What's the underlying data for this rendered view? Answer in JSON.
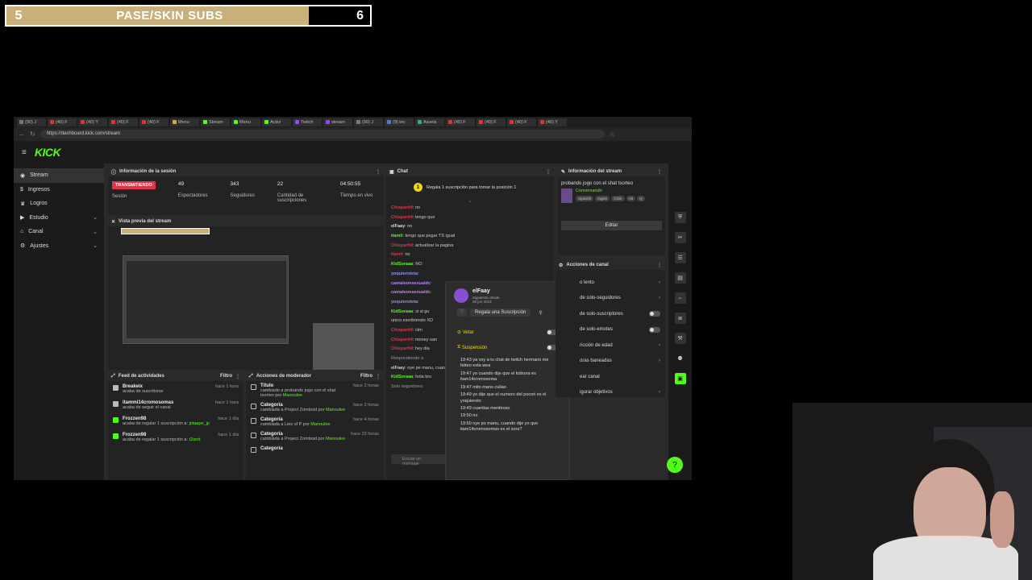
{
  "overlay": {
    "left_count": "5",
    "title": "PASE/SKIN SUBS",
    "right_count": "6"
  },
  "browser": {
    "tabs": [
      {
        "label": "(90) J",
        "color": "#777"
      },
      {
        "label": "(40) F",
        "color": "#d33"
      },
      {
        "label": "(40) Y",
        "color": "#d33"
      },
      {
        "label": "(40) F",
        "color": "#d33"
      },
      {
        "label": "(40) F",
        "color": "#d33"
      },
      {
        "label": "Menu",
        "color": "#c9b040"
      },
      {
        "label": "Stream",
        "color": "#53fc18"
      },
      {
        "label": "Menu",
        "color": "#53fc18"
      },
      {
        "label": "Activi",
        "color": "#53fc18"
      },
      {
        "label": "Twitch",
        "color": "#9146ff"
      },
      {
        "label": "stream",
        "color": "#9146ff"
      },
      {
        "label": "(90) J",
        "color": "#777"
      },
      {
        "label": "(9) tec",
        "color": "#4a7bd9"
      },
      {
        "label": "Assets",
        "color": "#3a9"
      },
      {
        "label": "(40) F",
        "color": "#d33"
      },
      {
        "label": "(40) F",
        "color": "#d33"
      },
      {
        "label": "(40) F",
        "color": "#d33"
      },
      {
        "label": "(40) Y",
        "color": "#d33"
      }
    ],
    "url": "https://dashboard.kick.com/stream"
  },
  "kick": {
    "logo": "KICK",
    "sidebar": [
      {
        "label": "Stream",
        "icon": "broadcast-icon",
        "active": true,
        "chevron": false
      },
      {
        "label": "Ingresos",
        "icon": "money-icon",
        "active": false,
        "chevron": false
      },
      {
        "label": "Logros",
        "icon": "trophy-icon",
        "active": false,
        "chevron": false
      },
      {
        "label": "Estudio",
        "icon": "video-icon",
        "active": false,
        "chevron": true
      },
      {
        "label": "Canal",
        "icon": "channel-icon",
        "active": false,
        "chevron": true
      },
      {
        "label": "Ajustes",
        "icon": "gear-icon",
        "active": false,
        "chevron": true
      }
    ],
    "session": {
      "title": "Información de la sesión",
      "live_badge": "TRANSMITIENDO",
      "live_sub": "Sesión",
      "stats": [
        {
          "value": "49",
          "label": "Espectadores"
        },
        {
          "value": "343",
          "label": "Seguidores"
        },
        {
          "value": "22",
          "label": "Cantidad de suscripciones"
        },
        {
          "value": "04:50:55",
          "label": "Tiempo en vivo"
        }
      ]
    },
    "preview_title": "Vista previa del stream",
    "activity": {
      "title": "Feed de actividades",
      "filter": "Filtro",
      "items": [
        {
          "name": "Breakeix",
          "text": "acaba de suscribirse",
          "time": "hace 1 hora",
          "color": "#bbb"
        },
        {
          "name": "itammi14cromosomas",
          "text": "acaba de seguir el canal",
          "time": "hace 1 hora",
          "color": "#bbb"
        },
        {
          "name": "Frozzen98",
          "text": "acaba de regalar 1 suscripción a: ",
          "target": "jotaape_jp",
          "time": "hace 1 día",
          "color": "#53fc18"
        },
        {
          "name": "Frozzen98",
          "text": "acaba de regalar 1 suscripción a: ",
          "target": "t2arot",
          "time": "hace 1 día",
          "color": "#53fc18"
        }
      ]
    },
    "mod_actions": {
      "title": "Acciones de moderador",
      "filter": "Filtro",
      "items": [
        {
          "name": "Título",
          "text": "cambiado a probando jogo con el shat tsorteo por",
          "by": "Manoulee",
          "time": "hace 2 horas"
        },
        {
          "name": "Categoría",
          "text": "cambiada a Project Zomboid por",
          "by": "Manoulee",
          "time": "hace 2 horas"
        },
        {
          "name": "Categoría",
          "text": "cambiada a Lies of P por",
          "by": "Manoulee",
          "time": "hace 4 horas"
        },
        {
          "name": "Categoría",
          "text": "cambiada a Project Zomboid por",
          "by": "Manoulee",
          "time": "hace 23 horas"
        },
        {
          "name": "Categoría",
          "text": "",
          "by": "",
          "time": ""
        }
      ]
    },
    "chat": {
      "title": "Chat",
      "pinned": "Regala 1 suscripción para tomar la posición 1",
      "lines": [
        {
          "user": "Chisparit4",
          "msg": "no",
          "color": "#e0344a"
        },
        {
          "user": "Chisparit4",
          "msg": "tengo que",
          "color": "#e0344a"
        },
        {
          "user": "elFaay",
          "msg": "no",
          "color": "#ddd"
        },
        {
          "user": "itamii",
          "msg": "tengo que pegar TS igual",
          "color": "#53fc18"
        },
        {
          "user": "Chisparit4",
          "msg": "actualizar la pagina",
          "color": "#e0344a"
        },
        {
          "user": "itamii",
          "msg": "no",
          "color": "#e0344a"
        },
        {
          "user": "KidSoraaa",
          "msg": "NO",
          "color": "#53fc18"
        },
        {
          "user": "yoquieroteta",
          "msg": "",
          "color": "#8f8fff"
        },
        {
          "user": "camaleonsexualdc",
          "msg": "",
          "color": "#c080ff"
        },
        {
          "user": "camaleonsexualdc",
          "msg": "",
          "color": "#c080ff"
        },
        {
          "user": "yoquieroteta",
          "msg": "",
          "color": "#8f8fff"
        },
        {
          "user": "KidSoraaa",
          "msg": "si si gu",
          "color": "#53fc18"
        },
        {
          "user": "",
          "msg": "unico escribiendo XD",
          "color": "#ddd"
        },
        {
          "user": "Chisparit4",
          "msg": "ctm",
          "color": "#e0344a"
        },
        {
          "user": "Chisparit4",
          "msg": "money uan",
          "color": "#e0344a"
        },
        {
          "user": "Chisparit4",
          "msg": "hey dia",
          "color": "#e0344a"
        }
      ],
      "reply_label": "Respondiendo a",
      "reply_user": "elFaay",
      "reply_msg": "oye pe manu, cuando dije yo que es sora?",
      "reply2_user": "KidSoraaa",
      "reply2_msg": "hola bro",
      "followers_only": "Solo seguidores",
      "input_placeholder": "Enviar un mensaje"
    },
    "usercard": {
      "name": "elFaay",
      "follow_label": "Siguiendo desde",
      "follow_date": "28 jun 2023",
      "gift_button": "Regala una Suscripción",
      "vetar": "Vetar",
      "suspension": "Suspensión",
      "messages": [
        "19:43 ya voy a tu chat de twitch hermano me fatteo esta wea",
        "19:47 yo cuando dije que el kidsora es itam14cromosoma",
        "19:47 mito mano culiao",
        "19:49 yo dije que el numero del pocori es el yoquieroto",
        "19:49 cuantias mentiroso",
        "19:50 no",
        "19:50 oye po manu, cuando dije yo que itam14cromosomas es el sora?"
      ]
    },
    "stream_info": {
      "title": "Información del stream",
      "stream_title": "probando jogo con el shat tsorteo",
      "category": "Conversando",
      "tags": [
        "Spanish",
        "Ingles",
        "Chile",
        "Hit",
        "ry"
      ],
      "edit_button": "Editar"
    },
    "channel_actions": {
      "title": "Acciones de canal",
      "items": [
        {
          "label": "o lento",
          "control": "chevron"
        },
        {
          "label": "de solo-seguidores",
          "control": "chevron"
        },
        {
          "label": "de solo-suscriptores",
          "control": "toggle"
        },
        {
          "label": "de solo-emotes",
          "control": "toggle"
        },
        {
          "label": "ricción de edad",
          "control": "chevron"
        },
        {
          "label": "oras baneadas",
          "control": "chevron"
        },
        {
          "label": "ear canal",
          "control": "none"
        },
        {
          "label": "igurar objetivos",
          "control": "chevron"
        }
      ]
    }
  }
}
